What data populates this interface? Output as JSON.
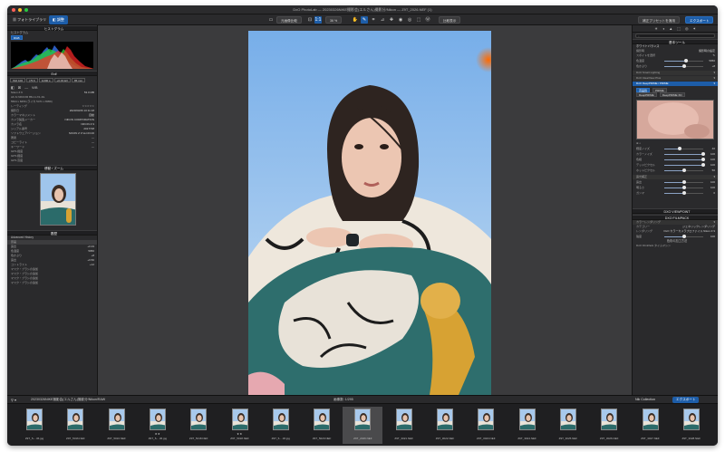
{
  "window": {
    "title": "DxO PhotoLab — 20230326NIKE撮影会(エルさん)撮影分/Nikon — Z9T_2026.NEF (1)"
  },
  "toolbar": {
    "tab_library": "フォトライブラリ",
    "tab_customize": "調整",
    "compare_label": "元画像比較",
    "zoom_label": "1:1",
    "zoom_percent": "36 %",
    "before_after_label": "比較表示",
    "preset_button": "補正プリセットを適用",
    "export_button": "エクスポート"
  },
  "left": {
    "histogram": {
      "title": "ヒストグラム",
      "mode": "ヒストグラム",
      "rgb": "RGB"
    },
    "exif": {
      "title": "Exif",
      "values": [
        "ISO 100",
        "ƒ/5.6",
        "1/200 s",
        "+0.33 EV",
        "85 mm"
      ],
      "wb_label": "WB",
      "camera": "Nikon Z 9",
      "size": "53.0 MB",
      "lens": "AF-S NIKKOR 85mm f/1.4G",
      "dims": "5504 x 8256 (ライカ 5471 x 8059)",
      "rating_label": "レーティング",
      "fields": [
        {
          "k": "撮影日",
          "v": "2023/03/26 10:11:18"
        },
        {
          "k": "カラーマネジメント",
          "v": "自動"
        },
        {
          "k": "カメラ製造メーカー",
          "v": "NIKON CORPORATION"
        },
        {
          "k": "カメラ名",
          "v": "NIKON Z 9"
        },
        {
          "k": "シリアル番号",
          "v": "2017728"
        },
        {
          "k": "ソフトウェアバージョン",
          "v": "NIKON Z 9 Ver.03.00"
        },
        {
          "k": "著者",
          "v": "—"
        },
        {
          "k": "コピーライト",
          "v": "—"
        },
        {
          "k": "キーワード",
          "v": "—"
        },
        {
          "k": "GPS 緯度",
          "v": ""
        },
        {
          "k": "GPS 経度",
          "v": ""
        },
        {
          "k": "GPS 高度",
          "v": ""
        }
      ]
    },
    "navigator": {
      "title": "移動 / ズーム"
    },
    "history": {
      "title": "履歴",
      "advanced": "Advanced History",
      "items": [
        {
          "k": "原画",
          "v": ""
        },
        {
          "k": "露出",
          "v": "+0.33"
        },
        {
          "k": "色温度",
          "v": "5950"
        },
        {
          "k": "色かぶり",
          "v": "+8"
        },
        {
          "k": "露出",
          "v": "+0.50"
        },
        {
          "k": "コントラスト",
          "v": "+12"
        },
        {
          "k": "マスク・ブラシの追加",
          "v": ""
        },
        {
          "k": "マスク・ブラシの追加",
          "v": ""
        },
        {
          "k": "マスク・ブラシの追加",
          "v": ""
        },
        {
          "k": "マスク・ブラシの追加",
          "v": ""
        }
      ]
    }
  },
  "right": {
    "title": "基本ツール",
    "white_balance": {
      "title": "ホワイトバランス",
      "mode_label": "撮影時",
      "mode_value": "撮影時の設定",
      "picker_label": "スポイトを選択",
      "sliders": [
        {
          "label": "色温度",
          "value": "5950",
          "frac": 0.55
        },
        {
          "label": "色かぶり",
          "value": "+8",
          "frac": 0.52
        }
      ]
    },
    "smart_lighting": "DxO Smart Lighting",
    "clearview": "DxO ClearView Plus",
    "denoise": {
      "title": "DxO DeepPRIME / PRIME",
      "modes": [
        "高品質",
        "PRIME",
        "DeepPRIME",
        "DeepPRIME XD"
      ],
      "mode_selected": "DeepPRIME",
      "sliders": [
        {
          "label": "輝度ノイズ",
          "value": "40",
          "frac": 0.4
        },
        {
          "label": "カラーノイズ",
          "value": "100",
          "frac": 1.0
        },
        {
          "label": "色相",
          "value": "100",
          "frac": 1.0
        },
        {
          "label": "デッドピクセル",
          "value": "100",
          "frac": 1.0
        },
        {
          "label": "ホットピクセル",
          "value": "50",
          "frac": 0.5
        }
      ]
    },
    "tone": {
      "title": "露光補正",
      "sliders": [
        {
          "label": "露出",
          "value": "100",
          "frac": 0.5
        },
        {
          "label": "明るさ",
          "value": "100",
          "frac": 0.5
        },
        {
          "label": "ガンマ",
          "value": "0",
          "frac": 0.5
        }
      ]
    },
    "viewpoint": "DXO VIEWPOINT",
    "filmpack": "DXO FILMPACK",
    "rendering": {
      "title": "カラーレンダリング",
      "category_label": "カテゴリー",
      "category_value": "ジェネリックレンダリング",
      "rendering_label": "レンダリング",
      "rendering_value": "DxO カラーカメラプロファイル Nikon Z 9",
      "intensity_label": "強度",
      "intensity_value": "100",
      "intensity_frac": 0.5,
      "section": "色彩の加工方法",
      "filmpack_label": "DxO FilmPack タイムマシン"
    }
  },
  "bottombar": {
    "path": "20230326NIKE撮影会(エルさん)撮影分/Nikon/RAW",
    "count": "画像数: 1/295",
    "collection": "Nik Collection",
    "export": "エクスポート"
  },
  "film": {
    "thumbs": [
      {
        "label": "Z9T_5-...36.jpg",
        "stars": ""
      },
      {
        "label": "Z9T_5016.NEF",
        "stars": ""
      },
      {
        "label": "Z9T_5016.NEF",
        "stars": ""
      },
      {
        "label": "Z9T_5-...36.jpg",
        "stars": "★★"
      },
      {
        "label": "Z9T_5018.NEF",
        "stars": ""
      },
      {
        "label": "Z9T_5018.NEF",
        "stars": "★★"
      },
      {
        "label": "Z9T_5-...36.jpg",
        "stars": ""
      },
      {
        "label": "Z9T_5020.NEF",
        "stars": ""
      },
      {
        "label": "Z9T_2026.NEF",
        "stars": ""
      },
      {
        "label": "Z9T_3021.NEF",
        "stars": ""
      },
      {
        "label": "Z9T_3022.NEF",
        "stars": ""
      },
      {
        "label": "Z9T_3023.NEF",
        "stars": ""
      },
      {
        "label": "Z9T_3024.NEF",
        "stars": ""
      },
      {
        "label": "Z9T_3025.NEF",
        "stars": ""
      },
      {
        "label": "Z9T_3026.NEF",
        "stars": ""
      },
      {
        "label": "Z9T_3027.NEF",
        "stars": ""
      },
      {
        "label": "Z9T_3028.NEF",
        "stars": ""
      }
    ],
    "selected_index": 8
  },
  "colors": {
    "accent": "#1d5da8",
    "panel": "#2a2a2c",
    "canvas": "#3b3b3d"
  }
}
